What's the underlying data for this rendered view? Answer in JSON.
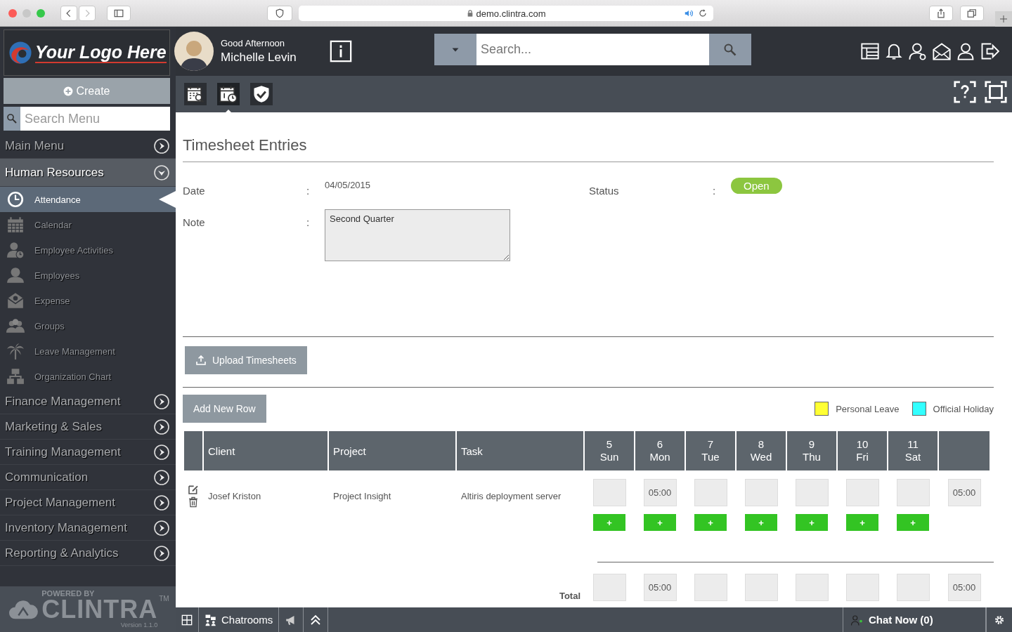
{
  "browser": {
    "url": "demo.clintra.com"
  },
  "sidebar": {
    "logo_text": "Your Logo Here",
    "create_button": "Create",
    "search_placeholder": "Search Menu",
    "menu": [
      {
        "label": "Main Menu",
        "expanded": false
      },
      {
        "label": "Human Resources",
        "expanded": true,
        "children": [
          {
            "label": "Attendance",
            "kind": "clock",
            "selected": true
          },
          {
            "label": "Calendar",
            "kind": "calendar",
            "selected": false
          },
          {
            "label": "Employee Activities",
            "kind": "person-clock",
            "selected": false
          },
          {
            "label": "Employees",
            "kind": "people",
            "selected": false
          },
          {
            "label": "Expense",
            "kind": "envelope",
            "selected": false
          },
          {
            "label": "Groups",
            "kind": "group",
            "selected": false
          },
          {
            "label": "Leave Management",
            "kind": "palm",
            "selected": false
          },
          {
            "label": "Organization Chart",
            "kind": "org",
            "selected": false
          }
        ]
      },
      {
        "label": "Finance Management",
        "expanded": false
      },
      {
        "label": "Marketing & Sales",
        "expanded": false
      },
      {
        "label": "Training Management",
        "expanded": false
      },
      {
        "label": "Communication",
        "expanded": false
      },
      {
        "label": "Project Management",
        "expanded": false
      },
      {
        "label": "Inventory Management",
        "expanded": false
      },
      {
        "label": "Reporting & Analytics",
        "expanded": false
      }
    ],
    "powered_by": "POWERED BY",
    "brand": "CLINTRA",
    "trademark": "TM",
    "version": "Version 1.1.0"
  },
  "header": {
    "greeting": "Good Afternoon",
    "user_name": "Michelle Levin",
    "search_placeholder": "Search..."
  },
  "toolbar": {
    "tabs": [
      {
        "kind": "calendar-search",
        "selected": false
      },
      {
        "kind": "calendar-clock",
        "selected": true
      },
      {
        "kind": "shield-check",
        "selected": false
      }
    ]
  },
  "page": {
    "title": "Timesheet Entries",
    "fields": [
      {
        "label": "Date",
        "separator": ":",
        "value": "04/05/2015"
      },
      {
        "label": "Status",
        "separator": ":",
        "value": "Open"
      },
      {
        "label": "Note",
        "separator": ":",
        "value": "Second Quarter"
      }
    ],
    "upload_button": "Upload Timesheets",
    "add_row_button": "Add New Row",
    "legend": [
      {
        "label": "Personal Leave",
        "color": "#ffff33"
      },
      {
        "label": "Official Holiday",
        "color": "#33ffff"
      }
    ]
  },
  "table": {
    "columns": [
      "Client",
      "Project",
      "Task"
    ],
    "days": [
      {
        "number": "5",
        "day": "Sun"
      },
      {
        "number": "6",
        "day": "Mon"
      },
      {
        "number": "7",
        "day": "Tue"
      },
      {
        "number": "8",
        "day": "Wed"
      },
      {
        "number": "9",
        "day": "Thu"
      },
      {
        "number": "10",
        "day": "Fri"
      },
      {
        "number": "11",
        "day": "Sat"
      }
    ],
    "rows": [
      {
        "client": "Josef Kriston",
        "project": "Project Insight",
        "task": "Altiris deployment server",
        "cells": [
          {
            "kind": "blank",
            "add_button": "+"
          },
          {
            "kind": "filled",
            "hours": "05:00",
            "add_button": "+"
          },
          {
            "kind": "blank",
            "add_button": "+"
          },
          {
            "kind": "blank",
            "add_button": "+"
          },
          {
            "kind": "blank",
            "add_button": "+"
          },
          {
            "kind": "blank",
            "add_button": "+"
          },
          {
            "kind": "blank",
            "add_button": "+"
          }
        ],
        "total": "05:00"
      }
    ],
    "totals": {
      "label": "Total",
      "cells": [
        {
          "kind": "blank"
        },
        {
          "kind": "filled",
          "hours": "05:00"
        },
        {
          "kind": "blank"
        },
        {
          "kind": "blank"
        },
        {
          "kind": "blank"
        },
        {
          "kind": "blank"
        },
        {
          "kind": "blank"
        }
      ],
      "total": "05:00"
    }
  },
  "footer": {
    "chatrooms": "Chatrooms",
    "chat_now": "Chat Now (0)"
  }
}
